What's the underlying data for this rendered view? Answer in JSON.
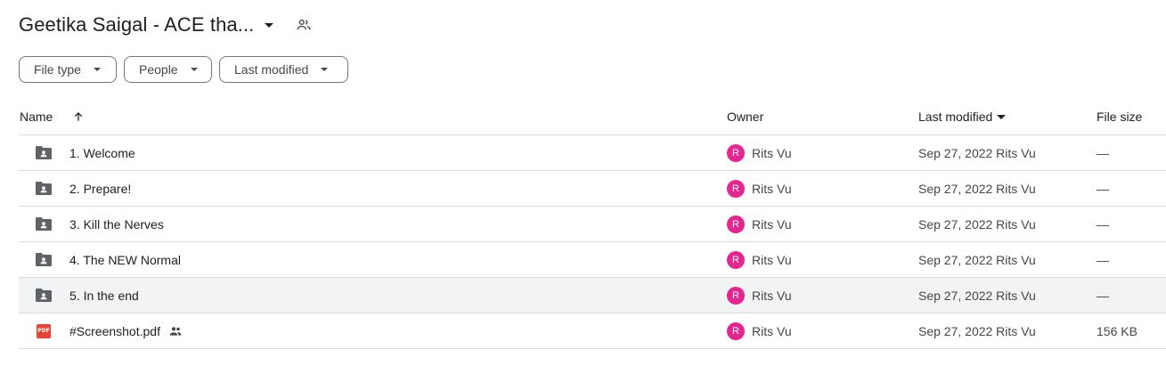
{
  "header": {
    "title": "Geetika Saigal - ACE tha...",
    "title_caret_icon": "arrow-drop-down-icon",
    "shared_icon": "people-icon"
  },
  "filters": [
    {
      "label": "File type"
    },
    {
      "label": "People"
    },
    {
      "label": "Last modified"
    }
  ],
  "columns": {
    "name": "Name",
    "owner": "Owner",
    "last_modified": "Last modified",
    "file_size": "File size",
    "sort_icon": "arrow-upward-icon",
    "sorted_by": "last_modified"
  },
  "rows": [
    {
      "icon": "shared-folder-icon",
      "name": "1. Welcome",
      "owner_initial": "R",
      "owner": "Rits Vu",
      "modified": "Sep 27, 2022 Rits Vu",
      "size": "—"
    },
    {
      "icon": "shared-folder-icon",
      "name": "2. Prepare!",
      "owner_initial": "R",
      "owner": "Rits Vu",
      "modified": "Sep 27, 2022 Rits Vu",
      "size": "—"
    },
    {
      "icon": "shared-folder-icon",
      "name": "3. Kill the Nerves",
      "owner_initial": "R",
      "owner": "Rits Vu",
      "modified": "Sep 27, 2022 Rits Vu",
      "size": "—"
    },
    {
      "icon": "shared-folder-icon",
      "name": "4. The NEW Normal",
      "owner_initial": "R",
      "owner": "Rits Vu",
      "modified": "Sep 27, 2022 Rits Vu",
      "size": "—"
    },
    {
      "icon": "shared-folder-icon",
      "name": "5. In the end",
      "owner_initial": "R",
      "owner": "Rits Vu",
      "modified": "Sep 27, 2022 Rits Vu",
      "size": "—"
    },
    {
      "icon": "pdf-icon",
      "icon_label": "PDF",
      "name": "#Screenshot.pdf",
      "owner_initial": "R",
      "owner": "Rits Vu",
      "modified": "Sep 27, 2022 Rits Vu",
      "size": "156 KB",
      "shared_icon": "people-icon"
    }
  ],
  "colors": {
    "avatar": "#e52592",
    "pdf": "#ea4335",
    "folder": "#5f6368",
    "row_hover": "#f1f3f4",
    "divider": "#dadce0"
  }
}
